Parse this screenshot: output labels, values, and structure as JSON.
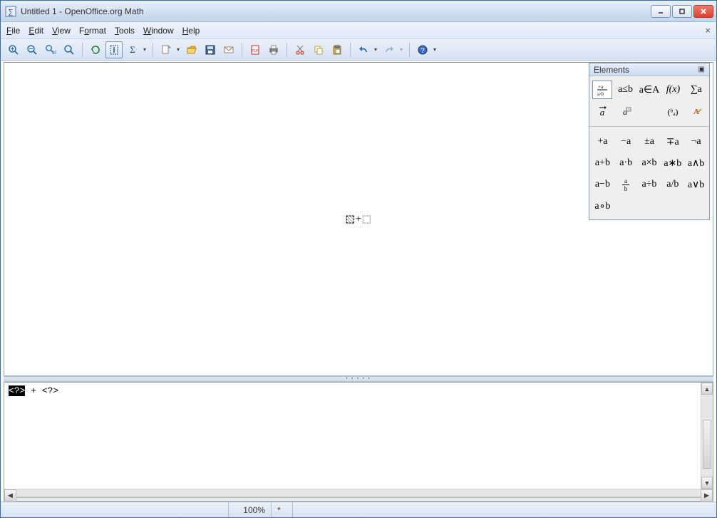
{
  "title": "Untitled 1 - OpenOffice.org Math",
  "menu": {
    "file": "File",
    "edit": "Edit",
    "view": "View",
    "format": "Format",
    "tools": "Tools",
    "window": "Window",
    "help": "Help"
  },
  "toolbar": {
    "zoom_in": "Zoom In",
    "zoom_out": "Zoom Out",
    "zoom_100": "100%",
    "zoom": "Zoom",
    "refresh": "Refresh",
    "cursor": "Formula Cursor",
    "catalog": "Catalog",
    "new": "New",
    "open": "Open",
    "save": "Save",
    "mail": "E-mail",
    "pdf": "Export PDF",
    "print": "Print",
    "cut": "Cut",
    "copy": "Copy",
    "paste": "Paste",
    "undo": "Undo",
    "redo": "Redo",
    "help": "Help"
  },
  "editor": {
    "selected": "<?>",
    "rest": " + <?>"
  },
  "preview": {
    "operator": "+"
  },
  "status": {
    "zoom": "100%",
    "modified": "*"
  },
  "elements": {
    "title": "Elements",
    "categories": [
      {
        "id": "unary-binary",
        "label": "+a∕a·b",
        "selected": true
      },
      {
        "id": "relations",
        "label": "a≤b"
      },
      {
        "id": "set",
        "label": "a∈A"
      },
      {
        "id": "functions",
        "label": "f(x)"
      },
      {
        "id": "operators",
        "label": "∑a"
      },
      {
        "id": "attributes",
        "label": "a⃗"
      },
      {
        "id": "others",
        "label": "a▫"
      },
      {
        "id": "brackets",
        "label": "(ᵃᵦ)"
      },
      {
        "id": "formats",
        "label": "A✎"
      }
    ],
    "ops": [
      "+a",
      "−a",
      "±a",
      "∓a",
      "¬a",
      "a+b",
      "a·b",
      "a×b",
      "a∗b",
      "a∧b",
      "a−b",
      "a⁄b",
      "a÷b",
      "a/b",
      "a∨b",
      "a∘b"
    ]
  }
}
